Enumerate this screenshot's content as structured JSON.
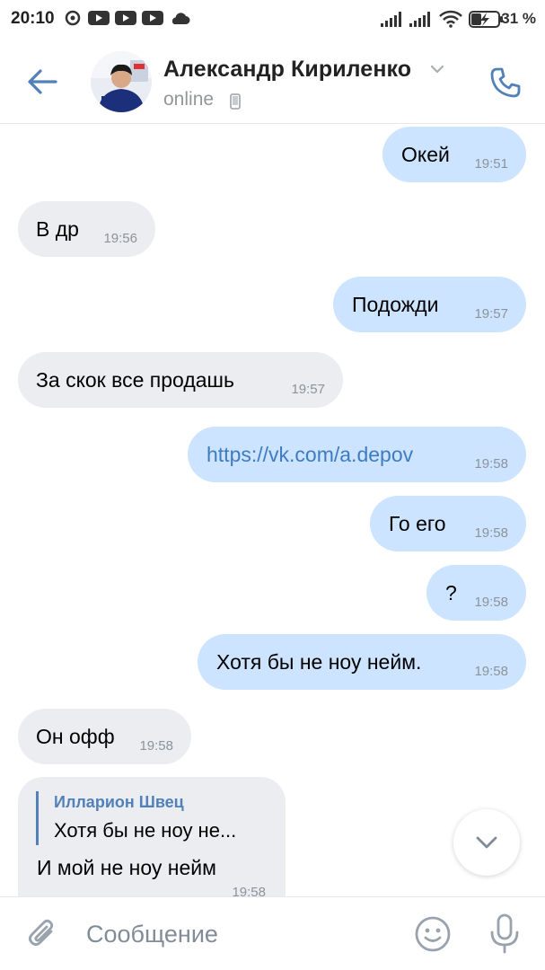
{
  "status_bar": {
    "time": "20:10",
    "battery": "31 %"
  },
  "header": {
    "contact_name": "Александр Кириленко",
    "status": "online"
  },
  "messages": [
    {
      "dir": "out",
      "text": "Окей",
      "time": "19:51"
    },
    {
      "dir": "in",
      "text": "В др",
      "time": "19:56"
    },
    {
      "dir": "out",
      "text": "Подожди",
      "time": "19:57"
    },
    {
      "dir": "in",
      "text": "За скок все продашь",
      "time": "19:57"
    },
    {
      "dir": "out",
      "text": "https://vk.com/a.depov",
      "time": "19:58",
      "link": true
    },
    {
      "dir": "out",
      "text": "Го его",
      "time": "19:58"
    },
    {
      "dir": "out",
      "text": "?",
      "time": "19:58"
    },
    {
      "dir": "out",
      "text": "Хотя бы не ноу нейм.",
      "time": "19:58"
    },
    {
      "dir": "in",
      "text": "Он офф",
      "time": "19:58"
    }
  ],
  "reply_message": {
    "quote_author": "Илларион Швец",
    "quote_text": "Хотя бы не ноу не...",
    "text": "И мой не ноу нейм",
    "time": "19:58"
  },
  "composer": {
    "placeholder": "Сообщение"
  },
  "colors": {
    "accent": "#5181b8",
    "outgoing_bubble": "#cce4ff",
    "incoming_bubble": "#ebedf0",
    "link": "#3f7cbf"
  },
  "icons": [
    "back-arrow-icon",
    "chevron-down-icon",
    "mobile-phone-icon",
    "phone-icon",
    "paperclip-icon",
    "emoji-icon",
    "microphone-icon"
  ]
}
